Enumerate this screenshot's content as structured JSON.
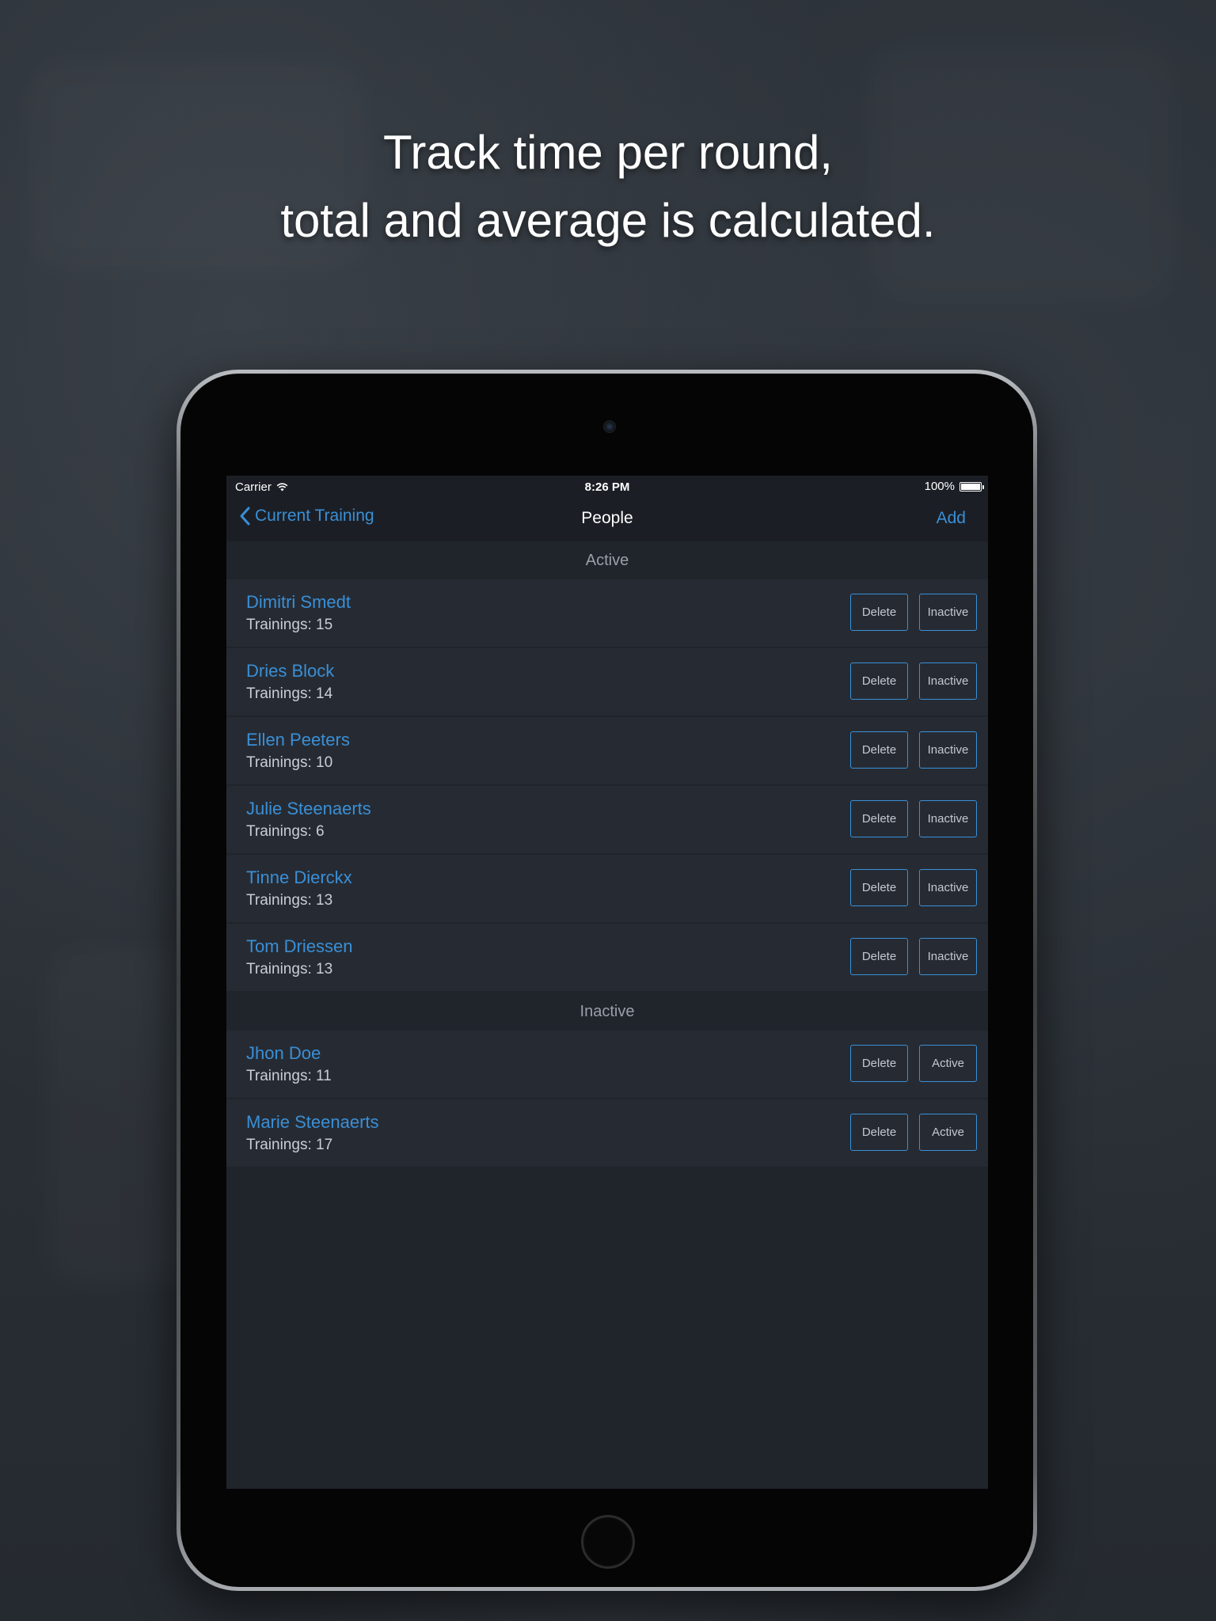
{
  "headline": {
    "line1": "Track time per round,",
    "line2": "total and average is calculated."
  },
  "statusbar": {
    "carrier": "Carrier",
    "time": "8:26 PM",
    "battery": "100%",
    "battery_level": 1.0
  },
  "navbar": {
    "back_label": "Current Training",
    "title": "People",
    "add_label": "Add"
  },
  "sections": [
    {
      "header": "Active",
      "toggle_label": "Inactive",
      "delete_label": "Delete",
      "people": [
        {
          "name": "Dimitri Smedt",
          "trainings": "Trainings: 15"
        },
        {
          "name": "Dries Block",
          "trainings": "Trainings: 14"
        },
        {
          "name": "Ellen Peeters",
          "trainings": "Trainings: 10"
        },
        {
          "name": "Julie Steenaerts",
          "trainings": "Trainings: 6"
        },
        {
          "name": "Tinne Dierckx",
          "trainings": "Trainings: 13"
        },
        {
          "name": "Tom Driessen",
          "trainings": "Trainings: 13"
        }
      ]
    },
    {
      "header": "Inactive",
      "toggle_label": "Active",
      "delete_label": "Delete",
      "people": [
        {
          "name": "Jhon Doe",
          "trainings": "Trainings: 11"
        },
        {
          "name": "Marie Steenaerts",
          "trainings": "Trainings: 17"
        }
      ]
    }
  ],
  "colors": {
    "accent": "#3a8fd6",
    "background": "#20242b",
    "row": "#262b33"
  }
}
